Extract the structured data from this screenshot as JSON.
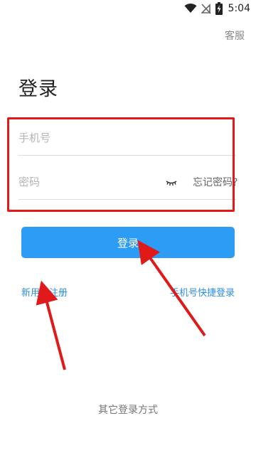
{
  "status_bar": {
    "time": "5:04",
    "icons": [
      "wifi-icon",
      "no-signal-icon",
      "battery-charging-icon"
    ]
  },
  "header": {
    "customer_service": "客服"
  },
  "page": {
    "title": "登录"
  },
  "form": {
    "phone_placeholder": "手机号",
    "password_placeholder": "密码",
    "forgot_password": "忘记密码?",
    "login_button": "登录"
  },
  "links": {
    "register": "新用户注册",
    "quick_login": "手机号快捷登录"
  },
  "footer": {
    "other_methods": "其它登录方式"
  },
  "colors": {
    "accent": "#2d9cf4",
    "link": "#2d8ee6",
    "annotation": "#e01a1a"
  }
}
